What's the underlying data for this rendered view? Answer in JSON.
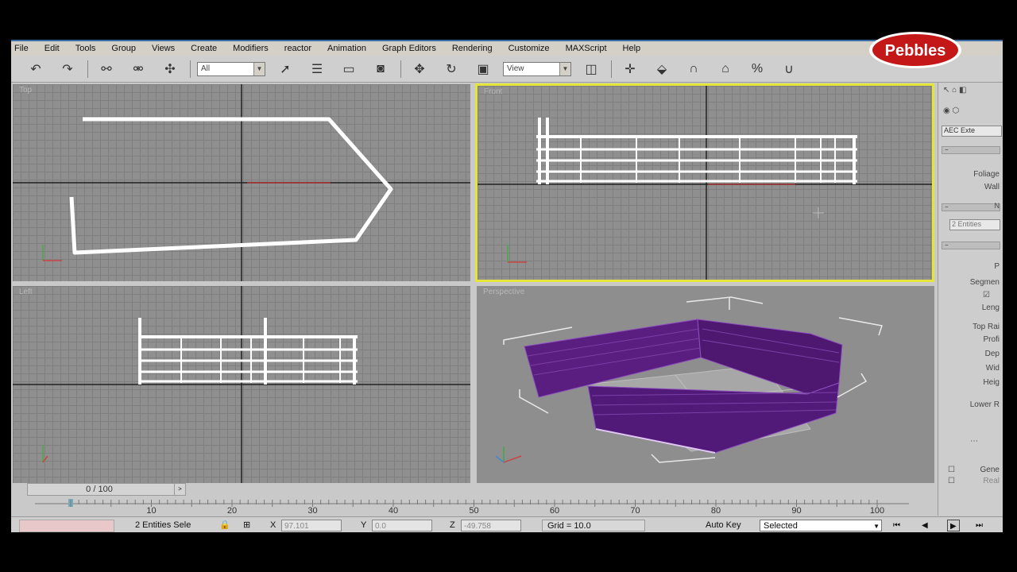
{
  "menu": [
    "File",
    "Edit",
    "Tools",
    "Group",
    "Views",
    "Create",
    "Modifiers",
    "reactor",
    "Animation",
    "Graph Editors",
    "Rendering",
    "Customize",
    "MAXScript",
    "Help"
  ],
  "toolbar": {
    "selection_filter": "All",
    "ref_coord": "View"
  },
  "viewports": {
    "top": "Top",
    "front": "Front",
    "left": "Left",
    "perspective": "Perspective"
  },
  "accent_colors": {
    "active_viewport": "#e4e43a",
    "fence_object": "#5a1e80",
    "wireframe": "#ffffff"
  },
  "command_panel": {
    "dropdown": "AEC Exte",
    "foliage": "Foliage",
    "wall": "Wall",
    "name_header": "N",
    "selection": "2 Entities",
    "p_label": "P",
    "segments": "Segmen",
    "length": "Leng",
    "top_rail": "Top Rai",
    "profile": "Profi",
    "depth": "Dep",
    "width": "Wid",
    "height": "Heig",
    "lower_rail": "Lower R",
    "gen": "Gene",
    "real": "Real"
  },
  "timeline": {
    "slider": "0 / 100",
    "ticks": [
      "10",
      "20",
      "30",
      "40",
      "50",
      "60",
      "70",
      "80",
      "90",
      "100"
    ]
  },
  "status": {
    "selection": "2 Entities Sele",
    "x_label": "X",
    "x_value": "97.101",
    "y_label": "Y",
    "y_value": "0.0",
    "z_label": "Z",
    "z_value": "-49.758",
    "grid": "Grid = 10.0",
    "auto_key": "Auto Key",
    "key_mode": "Selected"
  },
  "logo_text": "Pebbles"
}
